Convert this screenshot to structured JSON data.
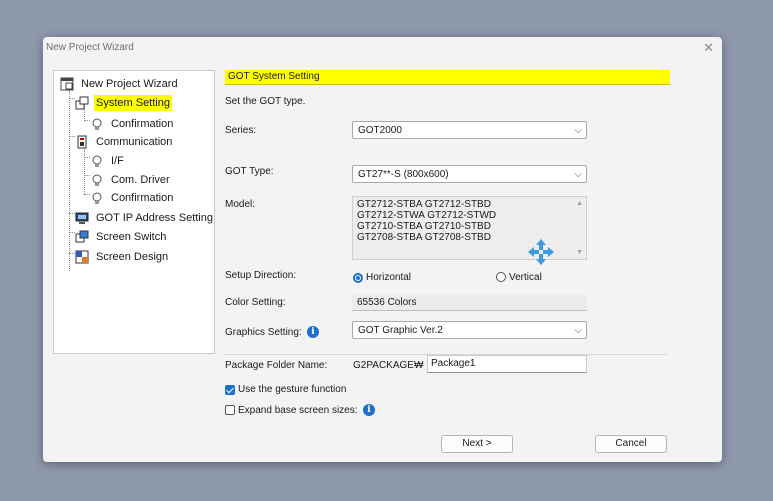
{
  "window": {
    "title": "New Project Wizard",
    "close_glyph": "✕"
  },
  "tree": {
    "items": [
      {
        "label": "New Project Wizard",
        "icon": "wizard-icon"
      },
      {
        "label": "System Setting",
        "icon": "system-setting-icon",
        "selected": true
      },
      {
        "label": "Confirmation",
        "icon": "bulb-icon"
      },
      {
        "label": "Communication",
        "icon": "communication-icon"
      },
      {
        "label": "I/F",
        "icon": "bulb-icon"
      },
      {
        "label": "Com. Driver",
        "icon": "bulb-icon"
      },
      {
        "label": "Confirmation",
        "icon": "bulb-icon"
      },
      {
        "label": "GOT IP Address Setting",
        "icon": "ip-address-icon"
      },
      {
        "label": "Screen Switch",
        "icon": "screen-switch-icon"
      },
      {
        "label": "Screen Design",
        "icon": "screen-design-icon"
      }
    ]
  },
  "form": {
    "section_title": "GOT System Setting",
    "instruction": "Set the GOT type.",
    "series_label": "Series:",
    "series_value": "GOT2000",
    "got_type_label": "GOT Type:",
    "got_type_value": "GT27**-S (800x600)",
    "model_label": "Model:",
    "models": [
      "GT2712-STBA   GT2712-STBD",
      "GT2712-STWA  GT2712-STWD",
      "GT2710-STBA   GT2710-STBD",
      "GT2708-STBA   GT2708-STBD"
    ],
    "setup_direction_label": "Setup Direction:",
    "direction_horizontal": "Horizontal",
    "direction_vertical": "Vertical",
    "direction_selected": "Horizontal",
    "color_setting_label": "Color Setting:",
    "color_setting_value": "65536 Colors",
    "graphics_setting_label": "Graphics Setting:",
    "graphics_setting_value": "GOT Graphic Ver.2",
    "package_folder_label": "Package Folder Name:",
    "package_prefix": "G2PACKAGE₩",
    "package_value": "Package1",
    "gesture_label": "Use the gesture function",
    "gesture_checked": true,
    "expand_label": "Expand base screen sizes:",
    "expand_checked": false,
    "info_glyph": "i"
  },
  "buttons": {
    "next": "Next >",
    "cancel": "Cancel"
  },
  "colors": {
    "highlight": "#ffff00",
    "accent": "#1d6fc9"
  }
}
